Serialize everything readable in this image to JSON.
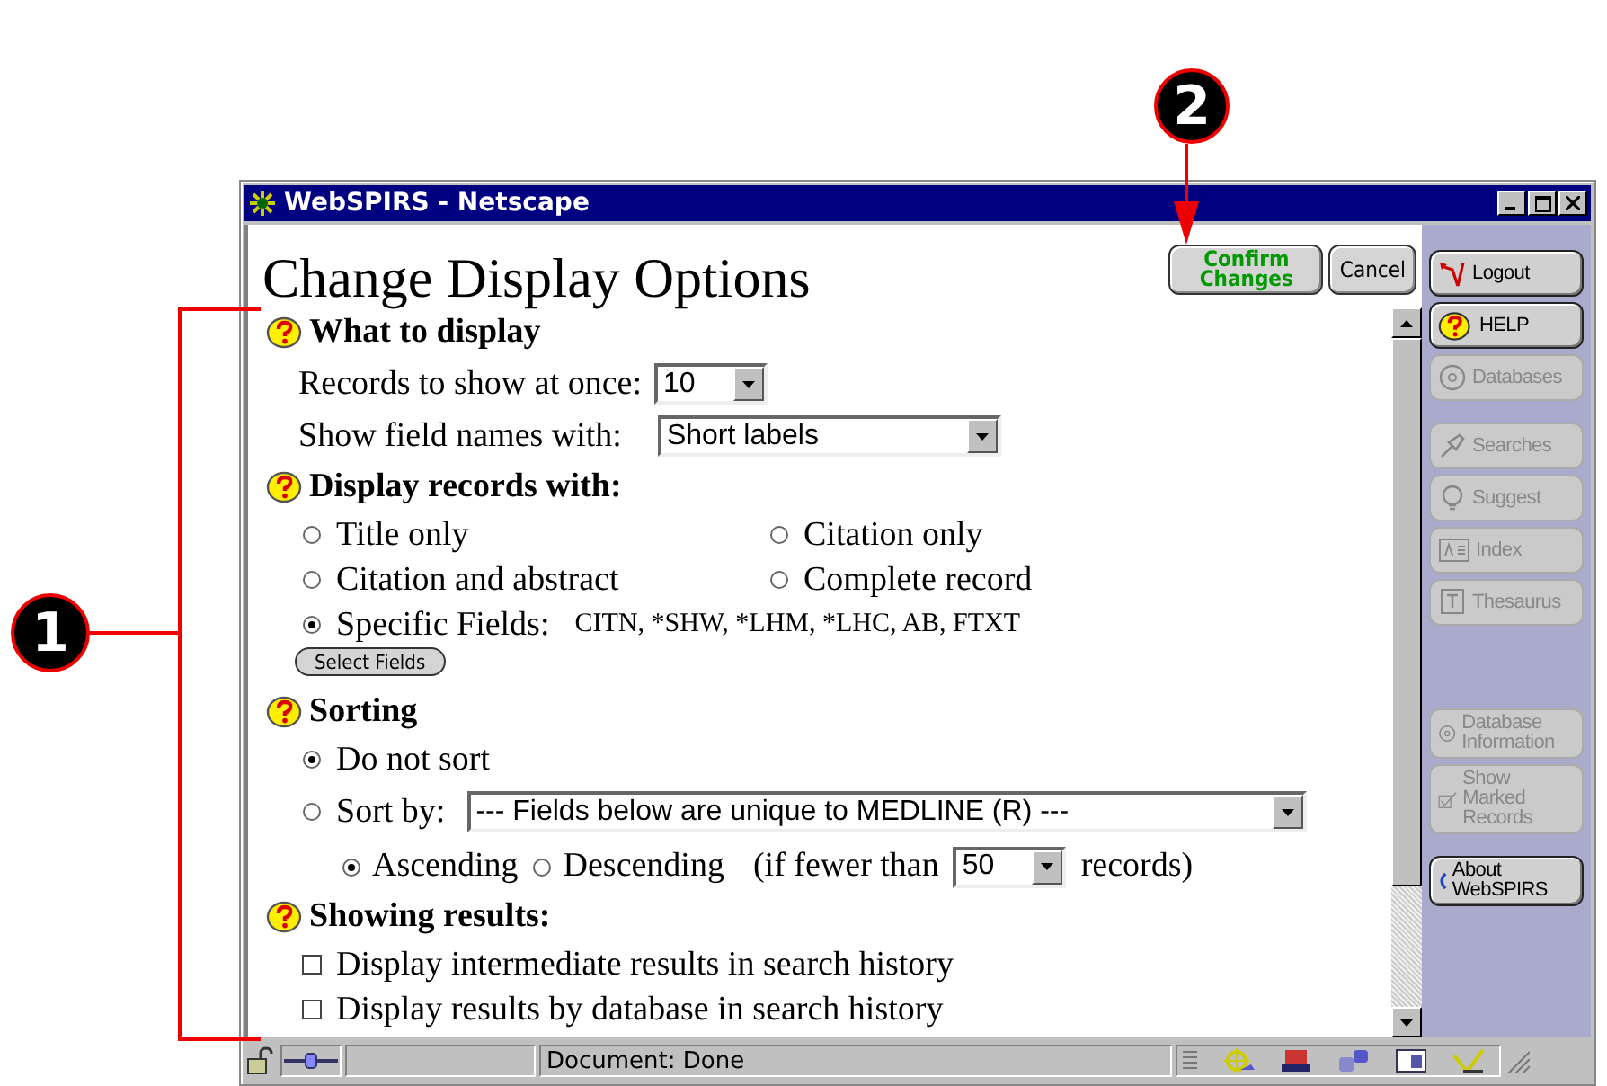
{
  "callouts": [
    {
      "label": "1"
    },
    {
      "label": "2"
    }
  ],
  "window": {
    "title": "WebSPIRS - Netscape"
  },
  "page": {
    "heading": "Change Display Options",
    "buttons": [
      {
        "label": "Confirm Changes",
        "kind": "primary"
      },
      {
        "label": "Cancel",
        "kind": "normal"
      }
    ]
  },
  "what_to_display": {
    "title": "What to display",
    "records_to_show": {
      "label": "Records to show at once:",
      "value": "10"
    },
    "field_names": {
      "label": "Show field names with:",
      "value": "Short labels"
    }
  },
  "display_records": {
    "title": "Display records with:",
    "options": [
      {
        "label": "Title only",
        "selected": false
      },
      {
        "label": "Citation only",
        "selected": false
      },
      {
        "label": "Citation and abstract",
        "selected": false
      },
      {
        "label": "Complete record",
        "selected": false
      }
    ],
    "specific": {
      "label": "Specific Fields:",
      "fields": "CITN, *SHW, *LHM, *LHC, AB, FTXT",
      "selected": true
    },
    "select_button": "Select Fields"
  },
  "sorting": {
    "title": "Sorting",
    "options": [
      {
        "label": "Do not sort",
        "selected": true
      },
      {
        "label": "Sort by:",
        "selected": false
      }
    ],
    "sort_field": "--- Fields below are unique to MEDLINE (R) ---",
    "order": [
      {
        "label": "Ascending",
        "selected": true
      },
      {
        "label": "Descending",
        "selected": false
      }
    ],
    "limit_prefix": "(if fewer than",
    "limit": "50",
    "limit_suffix": "records)"
  },
  "showing_results": {
    "title": "Showing results:",
    "options": [
      {
        "label": "Display intermediate results in search history",
        "checked": false
      },
      {
        "label": "Display results by database in search history",
        "checked": false
      }
    ]
  },
  "sidebar": {
    "groups": [
      [
        {
          "label": "Logout",
          "kind": "logout",
          "disabled": false
        },
        {
          "label": "HELP",
          "kind": "help",
          "disabled": false
        },
        {
          "label": "Databases",
          "kind": "databases",
          "disabled": true
        }
      ],
      [
        {
          "label": "Searches",
          "kind": "searches",
          "disabled": true
        },
        {
          "label": "Suggest",
          "kind": "suggest",
          "disabled": true
        },
        {
          "label": "Index",
          "kind": "index",
          "disabled": true
        },
        {
          "label": "Thesaurus",
          "kind": "thesaurus",
          "disabled": true
        }
      ],
      [
        {
          "label": "Database Information",
          "kind": "dbinfo",
          "disabled": true
        },
        {
          "label": "Show Marked Records",
          "kind": "marked",
          "disabled": true
        }
      ],
      [
        {
          "label": "About WebSPIRS",
          "kind": "about",
          "disabled": false
        }
      ]
    ]
  },
  "status_bar": {
    "text": "Document: Done"
  }
}
